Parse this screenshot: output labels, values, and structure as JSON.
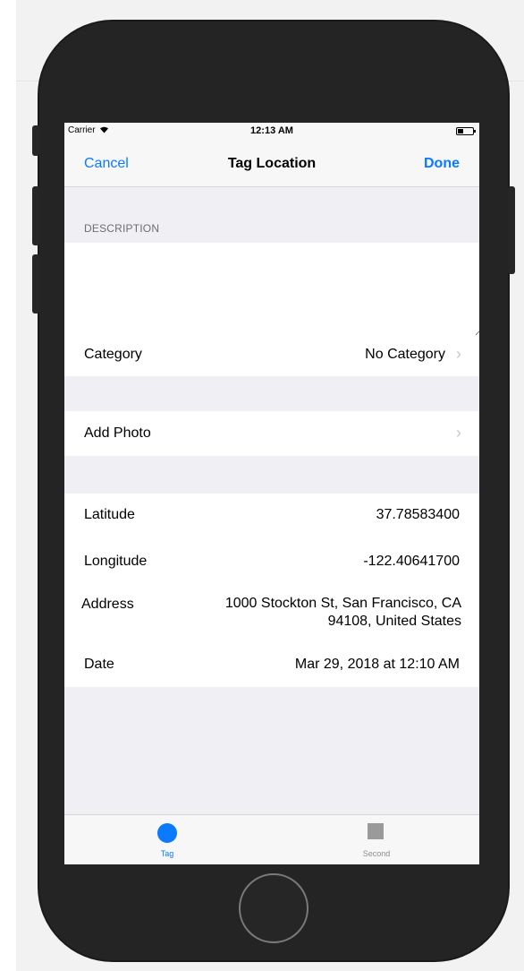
{
  "status_bar": {
    "carrier": "Carrier",
    "wifi_icon": "wifi-icon",
    "time": "12:13 AM",
    "battery_icon": "battery-icon"
  },
  "nav": {
    "cancel_label": "Cancel",
    "title": "Tag Location",
    "done_label": "Done"
  },
  "description": {
    "header": "DESCRIPTION",
    "text": ""
  },
  "category": {
    "label": "Category",
    "value": "No Category"
  },
  "photo": {
    "label": "Add Photo"
  },
  "info": {
    "latitude_label": "Latitude",
    "latitude_value": "37.78583400",
    "longitude_label": "Longitude",
    "longitude_value": "-122.40641700",
    "address_label": "Address",
    "address_line1": "1000 Stockton St, San Francisco, CA",
    "address_line2": "94108, United States",
    "date_label": "Date",
    "date_value": "Mar 29, 2018 at 12:10 AM"
  },
  "tabs": [
    {
      "label": "Tag",
      "icon": "circle-icon",
      "active": true
    },
    {
      "label": "Second",
      "icon": "square-icon",
      "active": false
    }
  ],
  "colors": {
    "accent": "#0a7aff",
    "grouped_background": "#efeff4",
    "bar_background": "#f7f7f7",
    "chevron": "#c7c7cc",
    "device_body": "#242424"
  }
}
